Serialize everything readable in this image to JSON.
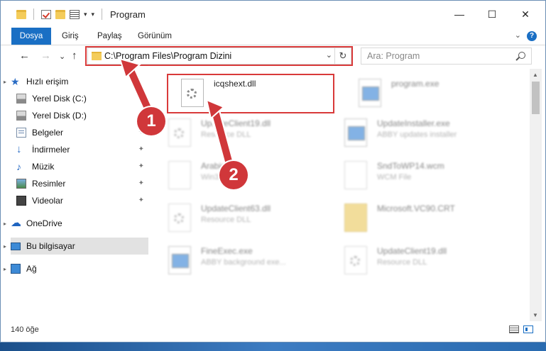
{
  "window": {
    "title": "Program",
    "minimize_glyph": "—",
    "maximize_glyph": "☐",
    "close_glyph": "✕"
  },
  "ribbon": {
    "tabs": [
      "Dosya",
      "Giriş",
      "Paylaş",
      "Görünüm"
    ],
    "collapse_glyph": "⌄",
    "help_glyph": "?",
    "accent_color": "#1a6fc4"
  },
  "nav": {
    "back_glyph": "←",
    "forward_glyph": "→",
    "recent_glyph": "⌄",
    "up_glyph": "↑",
    "address": "C:\\Program Files\\Program Dizini",
    "address_dropdown_glyph": "⌄",
    "refresh_glyph": "↻",
    "search_placeholder": "Ara: Program"
  },
  "sidebar": {
    "items": [
      {
        "label": "Hızlı erişim",
        "icon": "star-icon",
        "pinned": false
      },
      {
        "label": "Yerel Disk (C:)",
        "icon": "drive-icon",
        "pinned": false
      },
      {
        "label": "Yerel Disk (D:)",
        "icon": "drive-icon",
        "pinned": false
      },
      {
        "label": "Belgeler",
        "icon": "document-icon",
        "pinned": true
      },
      {
        "label": "İndirmeler",
        "icon": "download-icon",
        "pinned": true
      },
      {
        "label": "Müzik",
        "icon": "music-icon",
        "pinned": true
      },
      {
        "label": "Resimler",
        "icon": "pictures-icon",
        "pinned": true
      },
      {
        "label": "Videolar",
        "icon": "video-icon",
        "pinned": true
      },
      {
        "label": "OneDrive",
        "icon": "cloud-icon",
        "pinned": false
      },
      {
        "label": "Bu bilgisayar",
        "icon": "computer-icon",
        "pinned": false,
        "selected": true
      },
      {
        "label": "Ağ",
        "icon": "network-icon",
        "pinned": false
      }
    ],
    "pin_glyph": "📌"
  },
  "files": [
    {
      "name": "icqshext.dll",
      "desc": "",
      "icon": "dll-gear-icon",
      "highlighted": true
    },
    {
      "name": "program.exe",
      "desc": "",
      "icon": "exe-icon"
    },
    {
      "name": "UpdateClient19.dll",
      "desc": "Resource DLL",
      "icon": "dll-gear-icon"
    },
    {
      "name": "UpdateInstaller.exe",
      "desc": "ABBY updates installer",
      "icon": "exe-icon"
    },
    {
      "name": "Arabic.dll",
      "desc": "Win32 DLL",
      "icon": "file-icon"
    },
    {
      "name": "SndToWP14.wcm",
      "desc": "WCM File",
      "icon": "file-icon"
    },
    {
      "name": "UpdateClient63.dll",
      "desc": "Resource DLL",
      "icon": "dll-gear-icon"
    },
    {
      "name": "Microsoft.VC90.CRT",
      "desc": "",
      "icon": "folder-icon"
    },
    {
      "name": "FineExec.exe",
      "desc": "ABBY background exe...",
      "icon": "exe-icon"
    },
    {
      "name": "UpdateClient19.dll",
      "desc": "Resource DLL",
      "icon": "dll-gear-icon"
    }
  ],
  "status": {
    "count": "140 öğe"
  },
  "annotations": {
    "step1": "1",
    "step2": "2",
    "color": "#d0373a"
  }
}
